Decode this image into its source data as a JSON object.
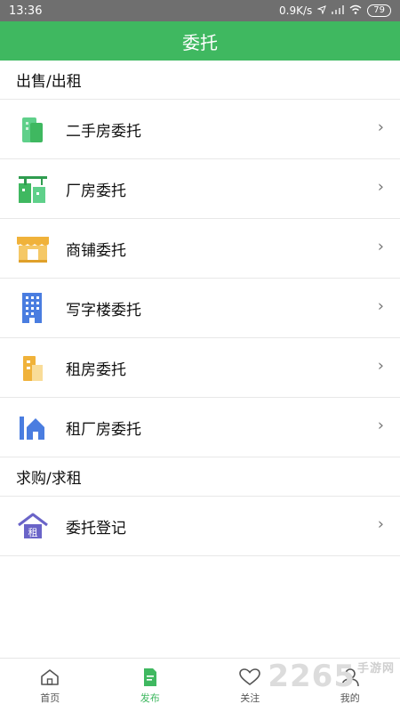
{
  "status": {
    "time": "13:36",
    "network_speed": "0.9K/s",
    "battery": "79"
  },
  "header": {
    "title": "委托"
  },
  "sections": [
    {
      "title": "出售/出租",
      "items": [
        {
          "label": "二手房委托",
          "icon": "building-icon"
        },
        {
          "label": "厂房委托",
          "icon": "factory-crane-icon"
        },
        {
          "label": "商铺委托",
          "icon": "shop-awning-icon"
        },
        {
          "label": "写字楼委托",
          "icon": "office-building-icon"
        },
        {
          "label": "租房委托",
          "icon": "rental-building-icon"
        },
        {
          "label": "租厂房委托",
          "icon": "rental-factory-icon"
        }
      ]
    },
    {
      "title": "求购/求租",
      "items": [
        {
          "label": "委托登记",
          "icon": "house-rent-icon",
          "badge": "租"
        }
      ]
    }
  ],
  "bottom_nav": [
    {
      "label": "首页",
      "icon": "home-icon"
    },
    {
      "label": "发布",
      "icon": "publish-document-icon",
      "active": true
    },
    {
      "label": "关注",
      "icon": "heart-icon"
    },
    {
      "label": "我的",
      "icon": "user-icon"
    }
  ],
  "watermark": {
    "main": "2265",
    "sub": "手游网"
  },
  "colors": {
    "accent": "#3fb860",
    "statusbar": "#6f6f6f"
  }
}
